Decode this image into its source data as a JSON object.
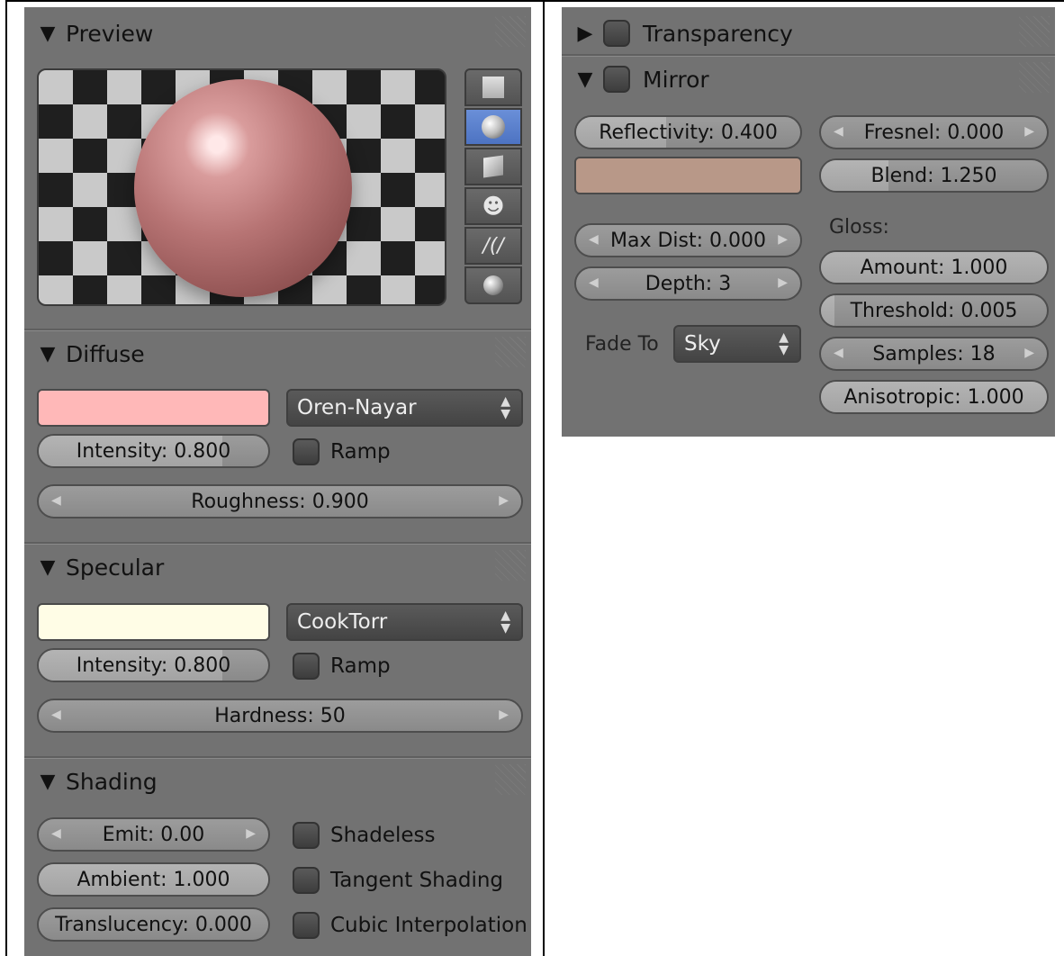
{
  "left_panel": {
    "preview": {
      "title": "Preview",
      "shape_buttons": [
        {
          "icon": "plane-icon",
          "active": false
        },
        {
          "icon": "sphere-icon",
          "active": true
        },
        {
          "icon": "cube-icon",
          "active": false
        },
        {
          "icon": "monkey-icon",
          "active": false
        },
        {
          "icon": "hair-icon",
          "active": false
        },
        {
          "icon": "sphere-atom-icon",
          "active": false
        }
      ]
    },
    "diffuse": {
      "title": "Diffuse",
      "color": "#ffb8b8",
      "shader": "Oren-Nayar",
      "intensity": "Intensity: 0.800",
      "intensity_value": 0.8,
      "ramp_label": "Ramp",
      "roughness": "Roughness: 0.900"
    },
    "specular": {
      "title": "Specular",
      "color": "#fffde6",
      "shader": "CookTorr",
      "intensity": "Intensity: 0.800",
      "intensity_value": 0.8,
      "ramp_label": "Ramp",
      "hardness": "Hardness: 50"
    },
    "shading": {
      "title": "Shading",
      "emit": "Emit: 0.00",
      "ambient": "Ambient: 1.000",
      "ambient_value": 1.0,
      "translucency": "Translucency: 0.000",
      "translucency_value": 0.0,
      "shadeless_label": "Shadeless",
      "tangent_label": "Tangent Shading",
      "cubic_label": "Cubic Interpolation"
    }
  },
  "right_panel": {
    "transparency": {
      "title": "Transparency"
    },
    "mirror": {
      "title": "Mirror",
      "reflectivity": "Reflectivity: 0.400",
      "reflectivity_value": 0.4,
      "color": "#b89888",
      "fresnel": "Fresnel: 0.000",
      "blend": "Blend: 1.250",
      "blend_value": 0.25,
      "max_dist": "Max Dist: 0.000",
      "depth": "Depth: 3",
      "fade_to_label": "Fade To",
      "fade_to_value": "Sky",
      "gloss_label": "Gloss:",
      "amount": "Amount: 1.000",
      "amount_value": 1.0,
      "threshold": "Threshold: 0.005",
      "threshold_value": 0.005,
      "samples": "Samples: 18",
      "anisotropic": "Anisotropic: 1.000",
      "anisotropic_value": 1.0
    }
  }
}
